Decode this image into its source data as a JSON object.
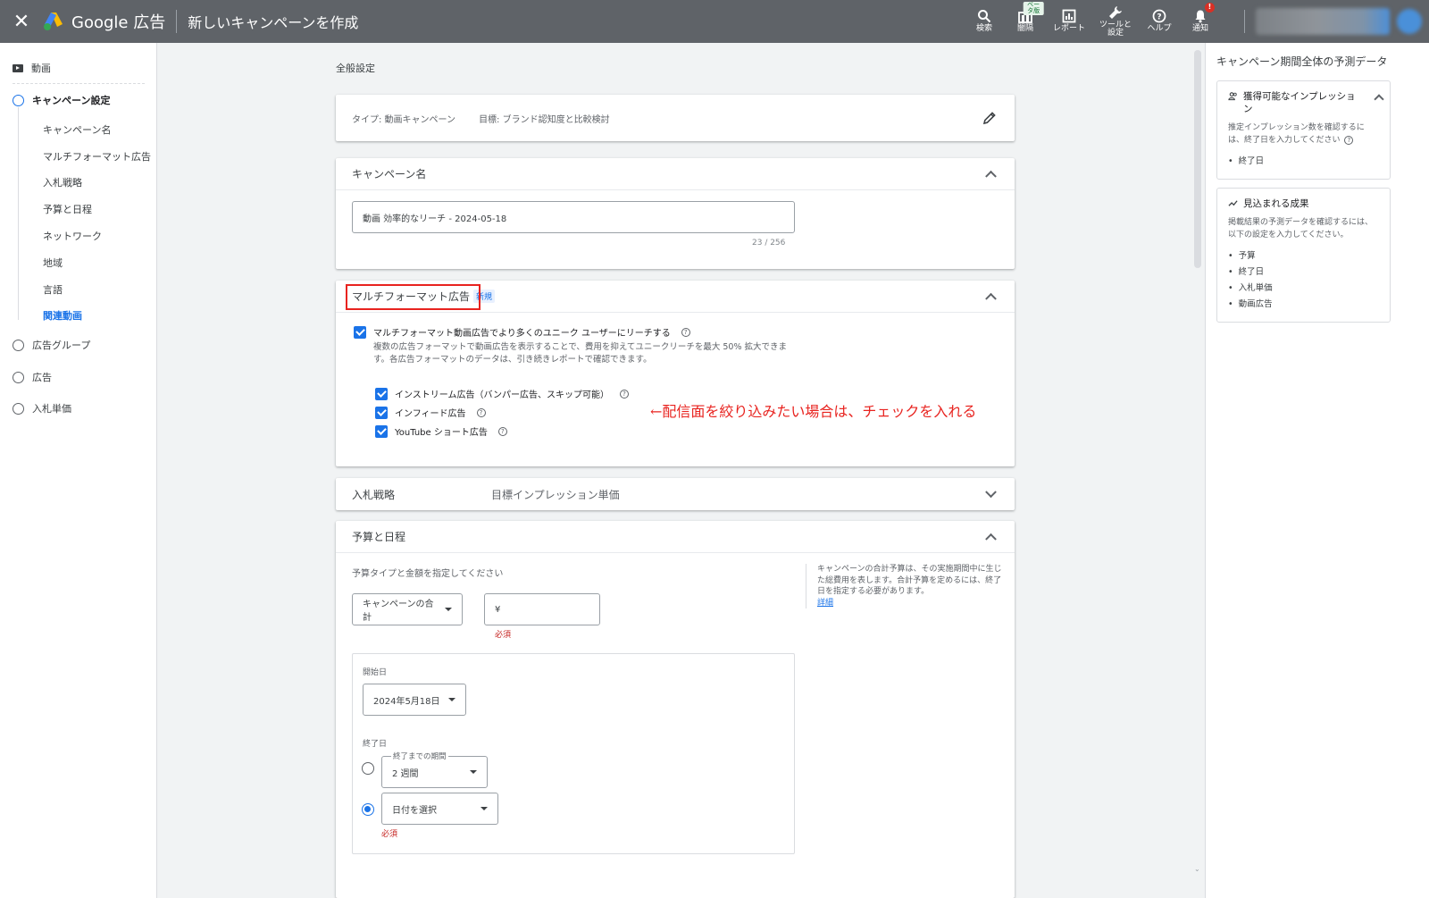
{
  "topbar": {
    "brand": "Google 広告",
    "page_title": "新しいキャンペーンを作成",
    "actions": [
      {
        "label": "検索",
        "icon": "search-icon"
      },
      {
        "label": "闇隔",
        "icon": "columns-icon",
        "badge": "ベータ版"
      },
      {
        "label": "レポート",
        "icon": "report-icon"
      },
      {
        "label": "ツールと\n設定",
        "icon": "wrench-icon"
      },
      {
        "label": "ヘルプ",
        "icon": "help-icon"
      },
      {
        "label": "通知",
        "icon": "bell-icon",
        "badge": "!"
      }
    ]
  },
  "sidebar": {
    "top_item": "動画",
    "steps": [
      {
        "label": "キャンペーン設定",
        "active": true
      },
      {
        "label": "広告グループ"
      },
      {
        "label": "広告"
      },
      {
        "label": "入札単価"
      }
    ],
    "substeps": [
      "キャンペーン名",
      "マルチフォーマット広告",
      "入札戦略",
      "予算と日程",
      "ネットワーク",
      "地域",
      "言語",
      "関連動画"
    ]
  },
  "main": {
    "section_label": "全般設定",
    "type_card": {
      "type_text": "タイプ: 動画キャンペーン",
      "goal_text": "目標: ブランド認知度と比較検討"
    },
    "name_card": {
      "title": "キャンペーン名",
      "value": "動画 効率的なリーチ - 2024-05-18",
      "counter": "23 / 256"
    },
    "multiformat_card": {
      "title": "マルチフォーマット広告",
      "badge": "新規",
      "main_checkbox": "マルチフォーマット動画広告でより多くのユニーク ユーザーにリーチする",
      "description": "複数の広告フォーマットで動画広告を表示することで、費用を抑えてユニークリーチを最大 50% 拡大できます。各広告フォーマットのデータは、引き続きレポートで確認できます。",
      "sub_checkboxes": [
        "インストリーム広告（バンパー広告、スキップ可能）",
        "インフィード広告",
        "YouTube ショート広告"
      ],
      "annotation": "←配信面を絞り込みたい場合は、チェックを入れる"
    },
    "bid_card": {
      "title": "入札戦略",
      "value": "目標インプレッション単価"
    },
    "budget_card": {
      "title": "予算と日程",
      "instruction": "予算タイプと金額を指定してください",
      "budget_type": "キャンペーンの合計",
      "currency": "¥",
      "required": "必須",
      "side_note": "キャンペーンの合計予算は、その実施期間中に生じた総費用を表します。合計予算を定めるには、終了日を指定する必要があります。",
      "side_link": "詳細",
      "start_label": "開始日",
      "start_value": "2024年5月18日",
      "end_label": "終了日",
      "duration_label": "終了までの期間",
      "duration_value": "2 週間",
      "date_select": "日付を選択",
      "required2": "必須"
    }
  },
  "right_panel": {
    "title": "キャンペーン期間全体の予測データ",
    "impressions_card": {
      "title": "獲得可能なインプレッション",
      "desc": "推定インプレッション数を確認するには、終了日を入力してください",
      "items": [
        "終了日"
      ]
    },
    "results_card": {
      "title": "見込まれる成果",
      "desc": "掲載結果の予測データを確認するには、以下の設定を入力してください。",
      "items": [
        "予算",
        "終了日",
        "入札単価",
        "動画広告"
      ]
    }
  },
  "colors": {
    "topbar": "#5f6368",
    "accent": "#1a73e8",
    "annotation_red": "#e8231f"
  }
}
